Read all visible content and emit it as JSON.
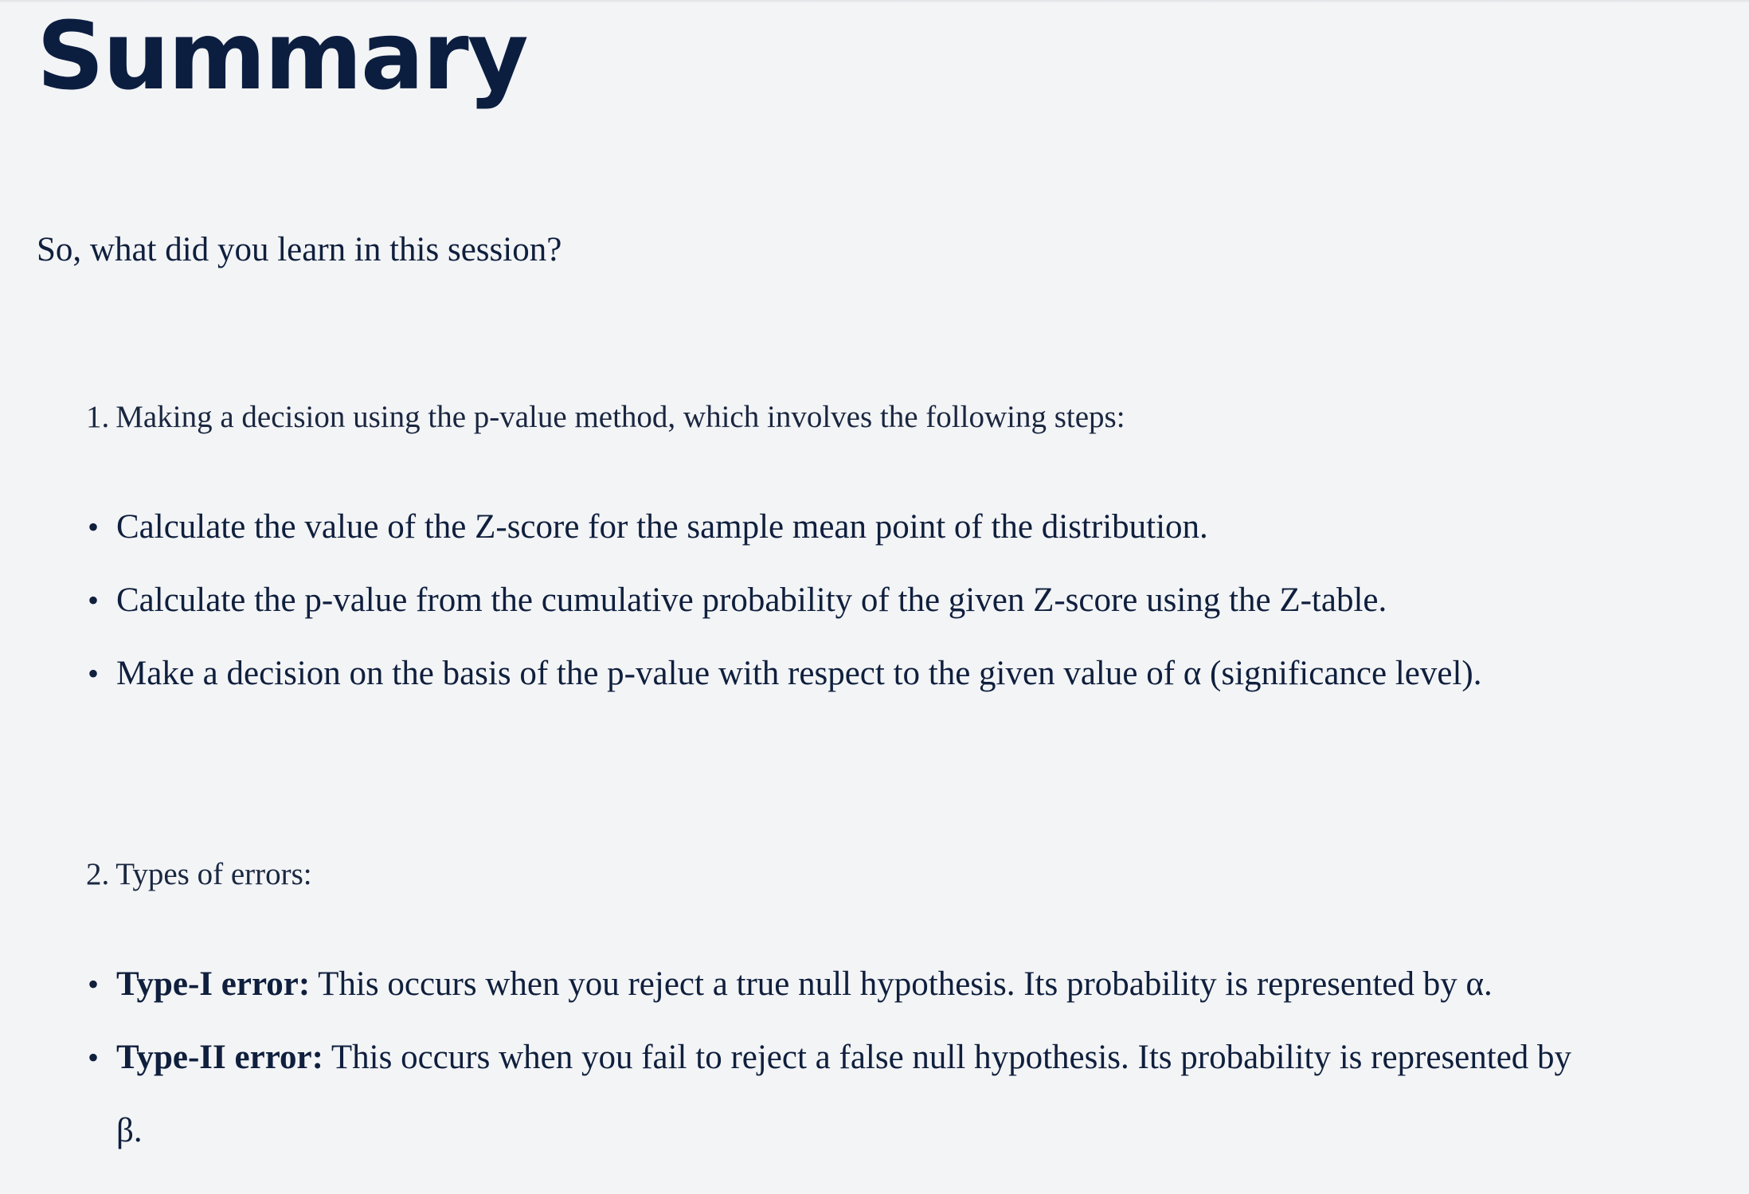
{
  "title": "Summary",
  "intro": "So, what did you learn in this session?",
  "sections": [
    {
      "number": "1.",
      "heading": "Making a decision using the p-value method, which involves the following steps:",
      "bullets": [
        "Calculate the value of the Z-score for the sample mean point of the distribution.",
        "Calculate the p-value from the cumulative probability of the given Z-score using the Z-table.",
        "Make a decision on the basis of the p-value with respect to the given value of α (significance level)."
      ]
    },
    {
      "number": "2.",
      "heading": "Types of errors:",
      "bullets": [
        {
          "label": "Type-I error:",
          "text": " This occurs when you reject a true null hypothesis. Its probability is represented by α."
        },
        {
          "label": "Type-II error:",
          "text": " This occurs when you fail to reject a false null hypothesis. Its probability is represented by β."
        }
      ]
    }
  ],
  "bullet_glyph": "•",
  "colors": {
    "background": "#f3f4f6",
    "title": "#0c1e40",
    "text": "#0f1f3d"
  }
}
